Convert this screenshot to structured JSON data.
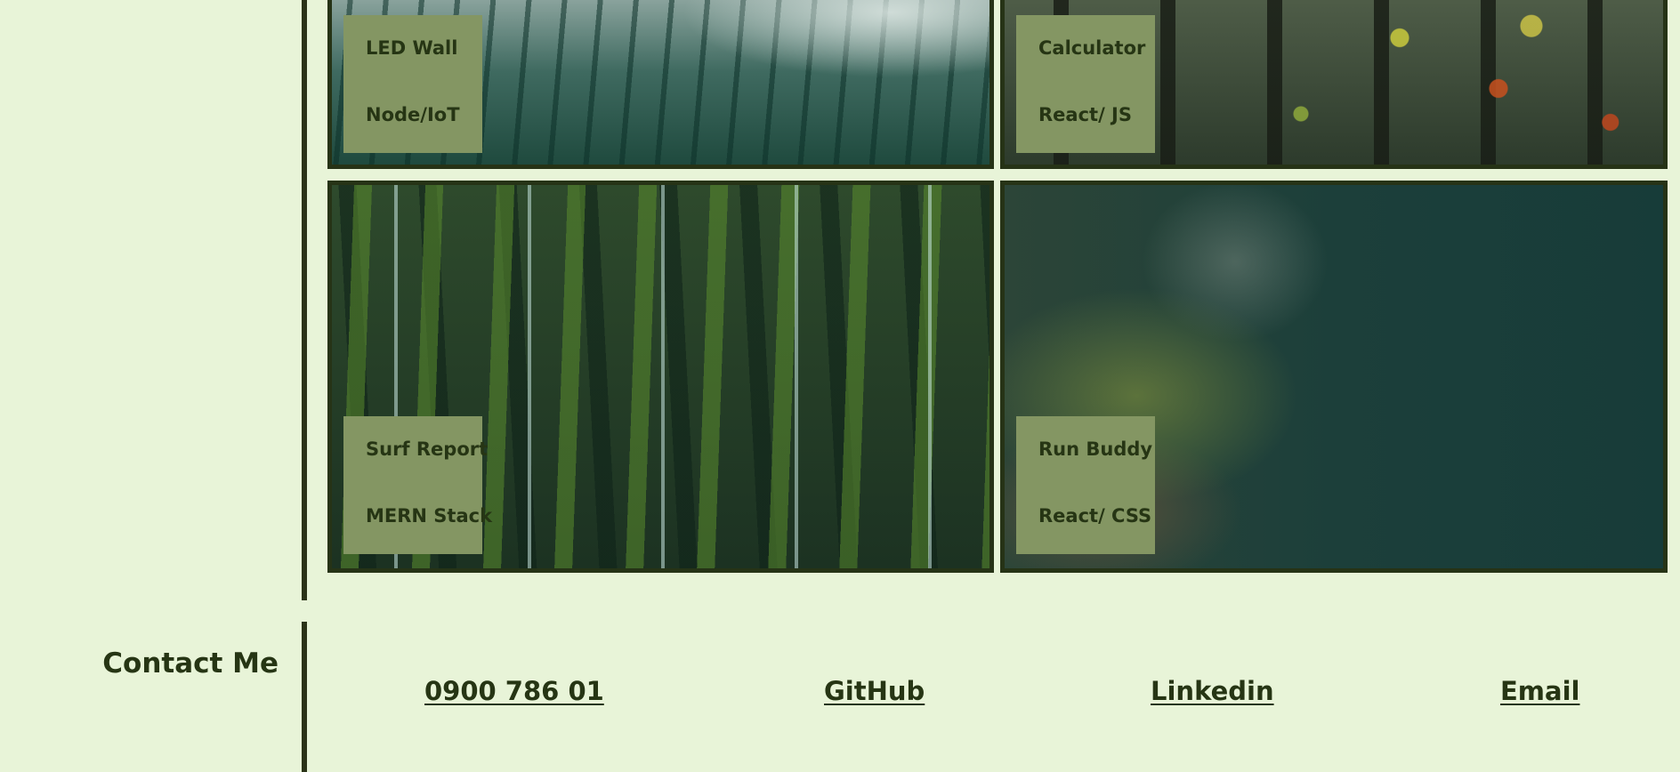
{
  "projects": [
    {
      "title": "LED Wall",
      "tech": "Node/IoT",
      "image": "misty-pine-forest"
    },
    {
      "title": "Calculator",
      "tech": "React/ JS",
      "image": "autumn-forest"
    },
    {
      "title": "Surf Report",
      "tech": "MERN Stack",
      "image": "tall-pine-trees"
    },
    {
      "title": "Run Buddy",
      "tech": "React/ CSS",
      "image": "blurred-forest"
    }
  ],
  "contact": {
    "heading": "Contact Me",
    "phone": "0900 786 01",
    "github": "GitHub",
    "linkedin": "Linkedin",
    "email": "Email"
  },
  "colors": {
    "background": "#e8f4d8",
    "text": "#263514",
    "label_box": "#849663",
    "border": "#263316"
  }
}
